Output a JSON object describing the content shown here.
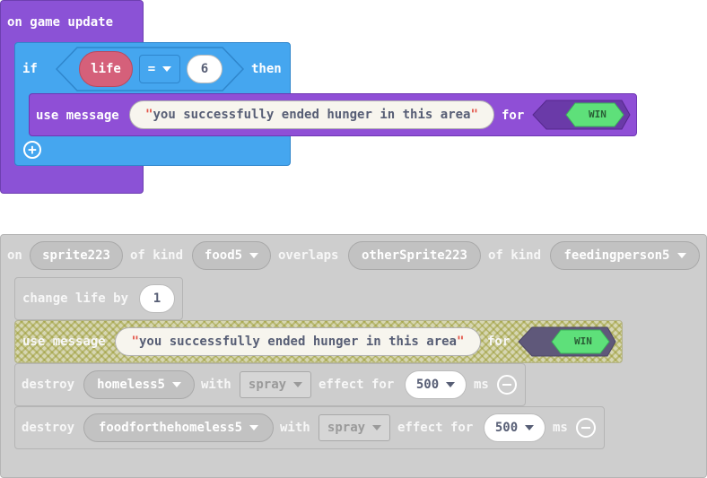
{
  "block1": {
    "hat_label": "on game update",
    "if_label": "if",
    "variable": "life",
    "operator": "=",
    "compare_value": "6",
    "then_label": "then",
    "use_label": "use message",
    "message_text": "you successfully ended hunger in this area",
    "for_label": "for",
    "win_label": "WIN",
    "quote_open": "\"",
    "quote_close": "\""
  },
  "block2": {
    "on_label": "on",
    "sprite": "sprite223",
    "of_kind_1": "of kind",
    "kind_1": "food5",
    "overlaps_label": "overlaps",
    "other_sprite": "otherSprite223",
    "of_kind_2": "of kind",
    "kind_2": "feedingperson5",
    "change_label": "change life by",
    "change_value": "1",
    "use_label": "use message",
    "message_text": "you successfully ended hunger in this area",
    "for_label": "for",
    "win_label": "WIN",
    "destroy_rows": [
      {
        "destroy_label": "destroy",
        "target": "homeless5",
        "with_label": "with",
        "effect": "spray",
        "effect_for_label": "effect for",
        "duration": "500",
        "ms_label": "ms"
      },
      {
        "destroy_label": "destroy",
        "target": "foodforthehomeless5",
        "with_label": "with",
        "effect": "spray",
        "effect_for_label": "effect for",
        "duration": "500",
        "ms_label": "ms"
      }
    ]
  },
  "colors": {
    "event_purple": "#8b52d6",
    "logic_blue": "#45a6ef",
    "variable_red": "#d5607a",
    "win_green": "#5ee07a",
    "disabled_gray": "#cecece"
  }
}
